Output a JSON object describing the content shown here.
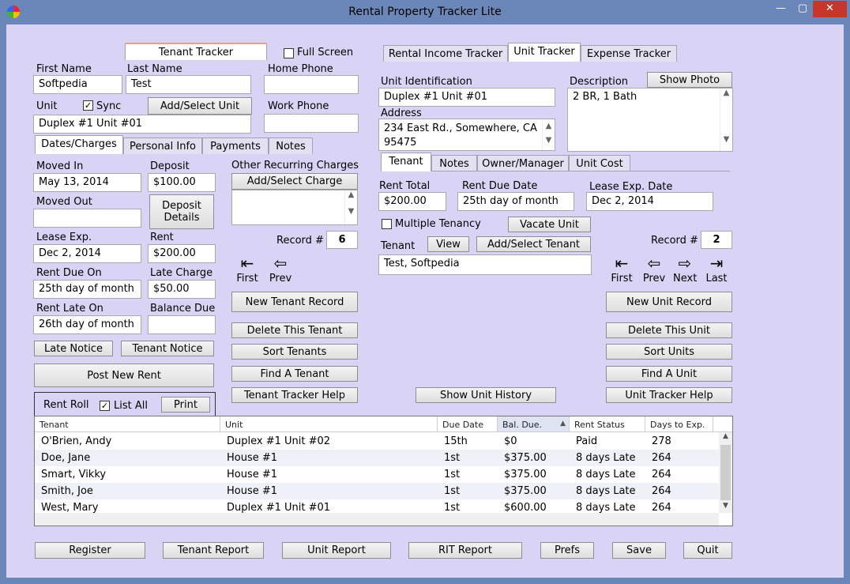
{
  "window": {
    "title": "Rental Property Tracker Lite",
    "min": "—",
    "max": "▢",
    "close": "✕"
  },
  "tenant_tracker": {
    "header": "Tenant Tracker",
    "full_screen": "Full Screen",
    "first_name_label": "First Name",
    "first_name": "Softpedia",
    "last_name_label": "Last Name",
    "last_name": "Test",
    "home_phone_label": "Home Phone",
    "home_phone": "",
    "unit_label": "Unit",
    "sync_label": "Sync",
    "sync_checked": "✓",
    "add_select_unit": "Add/Select Unit",
    "unit": "Duplex #1 Unit #01",
    "work_phone_label": "Work Phone",
    "work_phone": "",
    "tabs": [
      "Dates/Charges",
      "Personal Info",
      "Payments",
      "Notes"
    ],
    "moved_in_label": "Moved In",
    "moved_in": "May 13, 2014",
    "deposit_label": "Deposit",
    "deposit": "$100.00",
    "moved_out_label": "Moved Out",
    "moved_out": "",
    "deposit_details": "Deposit Details",
    "lease_exp_label": "Lease Exp.",
    "lease_exp": "Dec 2, 2014",
    "rent_label": "Rent",
    "rent": "$200.00",
    "rent_due_on_label": "Rent Due On",
    "rent_due_on": "25th day of month",
    "late_charge_label": "Late Charge",
    "late_charge": "$50.00",
    "rent_late_on_label": "Rent Late On",
    "rent_late_on": "26th day of month",
    "balance_due_label": "Balance Due",
    "balance_due": "",
    "other_recurring_label": "Other Recurring Charges",
    "add_select_charge": "Add/Select Charge",
    "late_notice": "Late Notice",
    "tenant_notice": "Tenant Notice",
    "post_new_rent": "Post New Rent",
    "record_label": "Record #",
    "record": "6",
    "first": "First",
    "prev": "Prev",
    "new_record": "New Tenant Record",
    "delete": "Delete This Tenant",
    "sort": "Sort Tenants",
    "find": "Find A Tenant",
    "help": "Tenant Tracker Help"
  },
  "unit_tracker": {
    "tabs": [
      "Rental Income Tracker",
      "Unit Tracker",
      "Expense Tracker"
    ],
    "unit_id_label": "Unit Identification",
    "unit_id": "Duplex #1 Unit #01",
    "description_label": "Description",
    "description": "2 BR, 1 Bath",
    "show_photo": "Show Photo",
    "address_label": "Address",
    "address_line1": "234 East Rd., Somewhere, CA",
    "address_line2": "95475",
    "subtabs": [
      "Tenant",
      "Notes",
      "Owner/Manager",
      "Unit Cost"
    ],
    "rent_total_label": "Rent Total",
    "rent_total": "$200.00",
    "rent_due_date_label": "Rent Due Date",
    "rent_due_date": "25th day of month",
    "lease_exp_date_label": "Lease Exp. Date",
    "lease_exp_date": "Dec 2, 2014",
    "multiple_tenancy": "Multiple Tenancy",
    "vacate_unit": "Vacate Unit",
    "tenant_label": "Tenant",
    "view": "View",
    "add_select_tenant": "Add/Select Tenant",
    "tenant": "Test, Softpedia",
    "record_label": "Record #",
    "record": "2",
    "first": "First",
    "prev": "Prev",
    "next": "Next",
    "last": "Last",
    "new_record": "New Unit Record",
    "delete": "Delete This Unit",
    "sort": "Sort Units",
    "find": "Find A Unit",
    "help": "Unit Tracker Help",
    "show_history": "Show Unit History"
  },
  "rent_roll": {
    "label": "Rent Roll",
    "list_all": "List All",
    "list_all_checked": "✓",
    "print": "Print",
    "columns": [
      "Tenant",
      "Unit",
      "Due Date",
      "Bal. Due.",
      "Rent Status",
      "Days to Exp."
    ],
    "sort_indicator": "▲",
    "rows": [
      [
        "O'Brien, Andy",
        "Duplex #1 Unit #02",
        "15th",
        "$0",
        "Paid",
        "278"
      ],
      [
        "Doe, Jane",
        "House #1",
        "1st",
        "$375.00",
        "8 days Late",
        "264"
      ],
      [
        "Smart, Vikky",
        "House #1",
        "1st",
        "$375.00",
        "8 days Late",
        "264"
      ],
      [
        "Smith, Joe",
        "House #1",
        "1st",
        "$375.00",
        "8 days Late",
        "264"
      ],
      [
        "West, Mary",
        "Duplex #1 Unit #01",
        "1st",
        "$600.00",
        "8 days Late",
        "264"
      ]
    ]
  },
  "bottom": {
    "register": "Register",
    "tenant_report": "Tenant Report",
    "unit_report": "Unit Report",
    "rit_report": "RIT Report",
    "prefs": "Prefs",
    "save": "Save",
    "quit": "Quit"
  },
  "icons": {
    "first": "⇤",
    "prev": "⇦",
    "next": "⇨",
    "last": "⇥",
    "scroll_up": "▲",
    "scroll_down": "▼"
  }
}
